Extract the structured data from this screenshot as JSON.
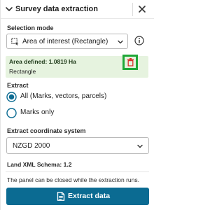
{
  "header": {
    "title": "Survey data extraction"
  },
  "selection_mode": {
    "label": "Selection mode",
    "value": "Area of interest (Rectangle)"
  },
  "area": {
    "defined": "Area defined: 1.0819 Ha",
    "shape": "Rectangle"
  },
  "extract": {
    "label": "Extract",
    "options": [
      {
        "label": "All (Marks, vectors, parcels)",
        "selected": true
      },
      {
        "label": "Marks only",
        "selected": false
      }
    ]
  },
  "coordinate_system": {
    "label": "Extract coordinate system",
    "value": "NZGD 2000"
  },
  "schema": "Land XML Schema: 1.2",
  "note": "The panel can be closed while the extraction runs.",
  "primary_button": {
    "label": "Extract data"
  },
  "colors": {
    "primary": "#0b6b92",
    "area_bg": "#e6f3df",
    "trash_border": "#1fa838",
    "trash_icon": "#d9302b"
  },
  "icons": {
    "collapse": "chevron-down-icon",
    "close": "close-icon",
    "selection": "rectangle-selection-icon",
    "info": "info-icon",
    "delete": "trash-icon",
    "button": "document-icon"
  }
}
